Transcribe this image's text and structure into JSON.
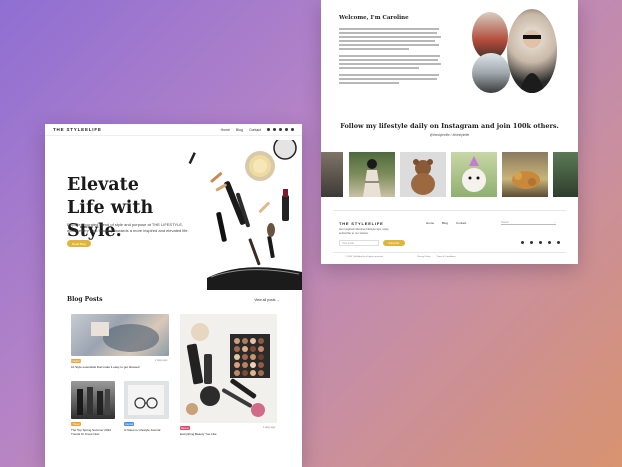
{
  "left_page": {
    "nav": {
      "logo": "THE STYLEELIFE",
      "links": [
        "Home",
        "Blog",
        "Contact"
      ]
    },
    "hero": {
      "title": "Elevate Life with Style.",
      "description": "Explore a curated blend of style and purpose at THE LIFESTYLE, where every post is a step towards a more inspired and elevated life.",
      "button": "Read Blog"
    },
    "blog": {
      "heading": "Blog Posts",
      "view_all": "View all posts →",
      "posts": [
        {
          "tag": "Fashion",
          "title": "10 Style essentials that make it easy to get dressed",
          "date": "2 days ago",
          "tag_color": "#e9a43c"
        },
        {
          "tag": "Beauty",
          "title": "Everything Beauty You Like",
          "date": "4 days ago",
          "tag_color": "#d94a6a"
        },
        {
          "tag": "Travel",
          "title": "The Top Spring Summer 2024 Trends To Know Now",
          "date": "1 week ago",
          "tag_color": "#e9a43c"
        },
        {
          "tag": "Journal",
          "title": "A Notes to Lifestyle Journal",
          "date": "1 week ago",
          "tag_color": "#4a8fe0"
        }
      ]
    }
  },
  "right_page": {
    "welcome": "Welcome, I'm Caroline",
    "instagram": {
      "heading": "Follow my lifestyle daily on Instagram and join 100k others.",
      "handle": "@thestyleelife / #thestylelife"
    },
    "footer": {
      "logo": "THE STYLEELIFE",
      "tagline": "Get inspired! Receive lifestyle tips, style, subscribe to our stories.",
      "email_placeholder": "Your email",
      "subscribe": "Subscribe",
      "links": [
        "Home",
        "Blog",
        "Contact"
      ],
      "search_placeholder": "Search",
      "copyright": "© 2024 TheStyleLife all rights reserved.",
      "legal": [
        "Privacy Policy",
        "Terms & Conditions"
      ]
    }
  },
  "colors": {
    "accent": "#e0b53a",
    "background_start": "#8f6fd3",
    "background_end": "#d8936f"
  }
}
